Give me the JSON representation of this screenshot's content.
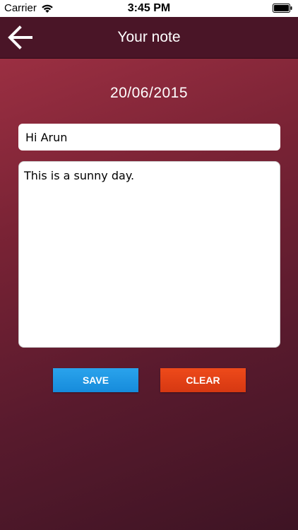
{
  "status_bar": {
    "carrier": "Carrier",
    "time": "3:45 PM",
    "icons": [
      "wifi-icon",
      "battery-icon"
    ]
  },
  "nav": {
    "title": "Your note",
    "back_icon": "back-arrow-icon"
  },
  "note": {
    "date": "20/06/2015",
    "title_value": "Hi Arun",
    "body_value": "This is a sunny day."
  },
  "actions": {
    "save_label": "SAVE",
    "clear_label": "CLEAR"
  },
  "colors": {
    "nav_background": "#4a1527",
    "content_gradient_start": "#9b2f42",
    "content_gradient_end": "#3e1424",
    "save_button": "#1e96e3",
    "clear_button": "#e3421a"
  }
}
